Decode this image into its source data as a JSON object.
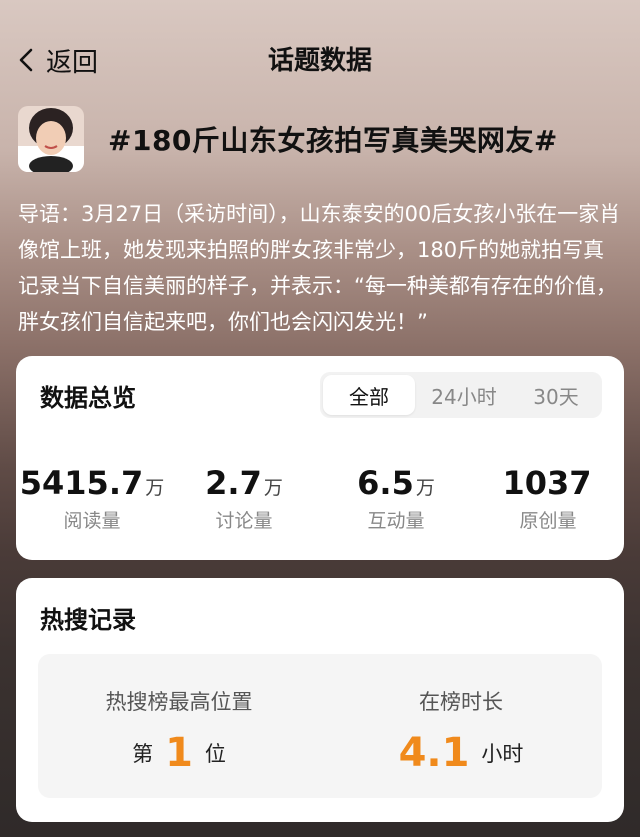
{
  "header": {
    "back_label": "返回",
    "title": "话题数据"
  },
  "topic": {
    "title": "#180斤山东女孩拍写真美哭网友#",
    "intro": "导语：3月27日（采访时间），山东泰安的00后女孩小张在一家肖像馆上班，她发现来拍照的胖女孩非常少，180斤的她就拍写真记录当下自信美丽的样子，并表示：“每一种美都有存在的价值，胖女孩们自信起来吧，你们也会闪闪发光！”"
  },
  "overview": {
    "title": "数据总览",
    "tabs": [
      "全部",
      "24小时",
      "30天"
    ],
    "active_tab": "全部",
    "stats": [
      {
        "value": "5415.7",
        "unit": "万",
        "label": "阅读量"
      },
      {
        "value": "2.7",
        "unit": "万",
        "label": "讨论量"
      },
      {
        "value": "6.5",
        "unit": "万",
        "label": "互动量"
      },
      {
        "value": "1037",
        "unit": "",
        "label": "原创量"
      }
    ]
  },
  "hot_search": {
    "title": "热搜记录",
    "peak": {
      "label": "热搜榜最高位置",
      "prefix": "第",
      "value": "1",
      "suffix": "位"
    },
    "duration": {
      "label": "在榜时长",
      "value": "4.1",
      "suffix": "小时"
    }
  },
  "colors": {
    "accent_orange": "#f08a1c"
  }
}
